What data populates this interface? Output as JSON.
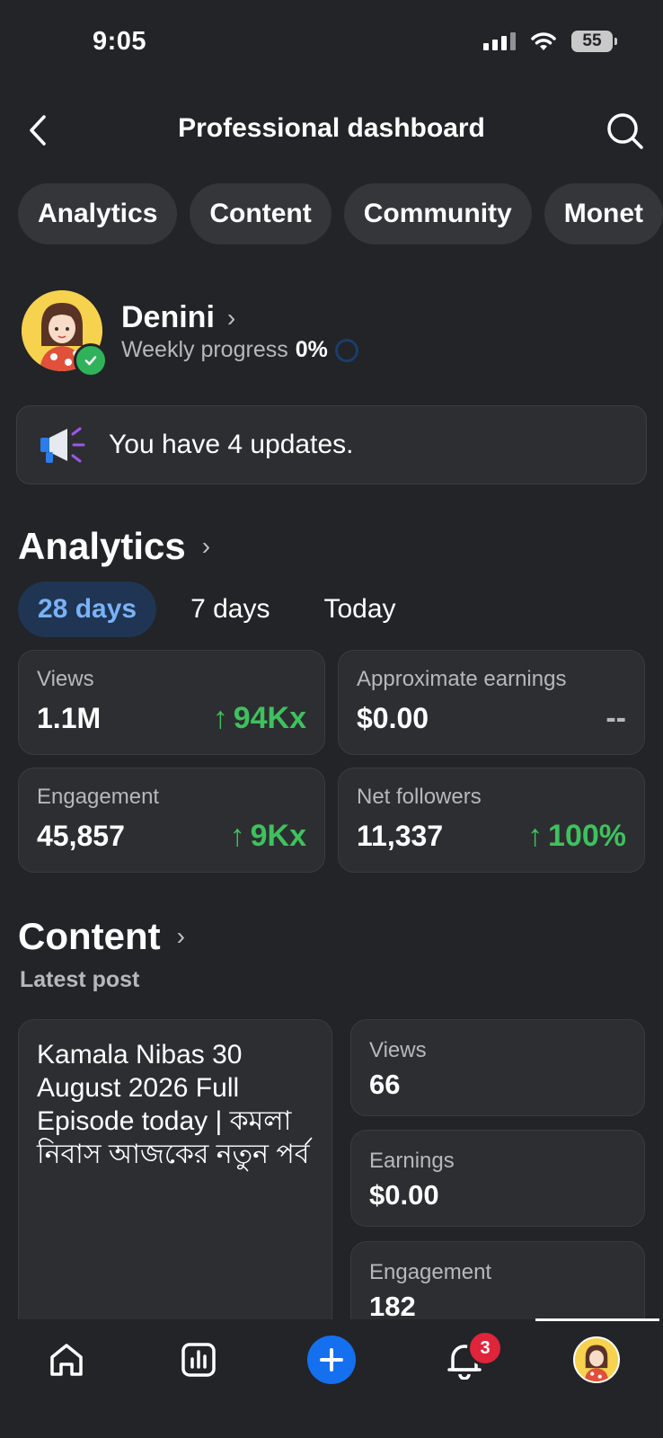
{
  "status_bar": {
    "time": "9:05",
    "battery": "55"
  },
  "header": {
    "title": "Professional dashboard"
  },
  "tabs": [
    "Analytics",
    "Content",
    "Community",
    "Monet"
  ],
  "profile": {
    "name": "Denini",
    "progress_label": "Weekly progress",
    "progress_value": "0%"
  },
  "updates": {
    "text": "You have 4 updates."
  },
  "analytics": {
    "title": "Analytics",
    "ranges": [
      "28 days",
      "7 days",
      "Today"
    ],
    "active_range": "28 days",
    "metrics": [
      {
        "label": "Views",
        "value": "1.1M",
        "delta": "94Kx",
        "trend": "up"
      },
      {
        "label": "Approximate earnings",
        "value": "$0.00",
        "delta": "--",
        "trend": "none"
      },
      {
        "label": "Engagement",
        "value": "45,857",
        "delta": "9Kx",
        "trend": "up"
      },
      {
        "label": "Net followers",
        "value": "11,337",
        "delta": "100%",
        "trend": "up"
      }
    ]
  },
  "content": {
    "title": "Content",
    "subtitle": "Latest post",
    "post_title": "Kamala Nibas 30 August 2026 Full Episode today | কমলা নিবাস আজকের নতুন পর্ব",
    "stats": [
      {
        "label": "Views",
        "value": "66"
      },
      {
        "label": "Earnings",
        "value": "$0.00"
      },
      {
        "label": "Engagement",
        "value": "182"
      }
    ]
  },
  "bottom_nav": {
    "items": [
      "home-icon",
      "insights-icon",
      "create-icon",
      "notifications-icon",
      "profile-avatar"
    ],
    "notification_count": "3"
  },
  "colors": {
    "background": "#232427",
    "card": "#2d2e31",
    "accent_blue": "#1570ef",
    "positive": "#3ec15e",
    "badge": "#e0243a"
  }
}
